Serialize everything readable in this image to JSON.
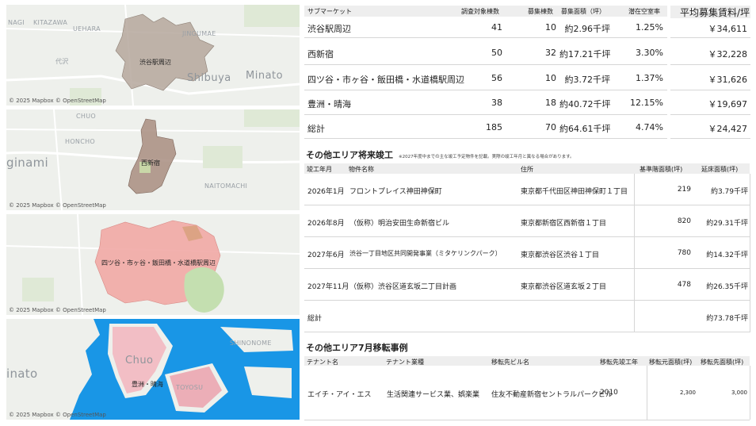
{
  "maps": [
    {
      "labels": [
        "NAGI",
        "KITAZAWA",
        "UEHARA",
        "JINGUMAE",
        "代沢",
        "Shibuya",
        "Minato"
      ],
      "area": "渋谷駅周辺",
      "copyright": "© 2025 Mapbox © OpenStreetMap",
      "color": "#b5a79c"
    },
    {
      "labels": [
        "CHUO",
        "HONCHO",
        "ginami",
        "NAITOMACHI"
      ],
      "area": "西新宿",
      "copyright": "© 2025 Mapbox © OpenStreetMap",
      "color": "#a88d80"
    },
    {
      "labels": [],
      "area": "四ツ谷・市ヶ谷・飯田橋・水道橋駅周辺",
      "copyright": "© 2025 Mapbox © OpenStreetMap",
      "color": "#f1a9a5"
    },
    {
      "labels": [
        "SHINONOME",
        "Chuo",
        "inato",
        "TOYOSU"
      ],
      "area": "豊洲・晴海",
      "copyright": "© 2025 Mapbox © OpenStreetMap",
      "color": "#eba6b1"
    }
  ],
  "submarket_table": {
    "headers": [
      "サブマーケット",
      "調査対象棟数",
      "募集棟数",
      "募集面積（坪）",
      "潜在空室率",
      "平均募集賃料/坪"
    ],
    "rows": [
      [
        "渋谷駅周辺",
        "41",
        "10",
        "約2.96千坪",
        "1.25%",
        "￥34,611"
      ],
      [
        "西新宿",
        "50",
        "32",
        "約17.21千坪",
        "3.30%",
        "￥32,228"
      ],
      [
        "四ツ谷・市ヶ谷・飯田橋・水道橋駅周辺",
        "56",
        "10",
        "約3.72千坪",
        "1.37%",
        "￥31,626"
      ],
      [
        "豊洲・晴海",
        "38",
        "18",
        "約40.72千坪",
        "12.15%",
        "￥19,697"
      ],
      [
        "総計",
        "185",
        "70",
        "約64.61千坪",
        "4.74%",
        "￥24,427"
      ]
    ]
  },
  "future_section": {
    "title": "その他エリア将来竣工",
    "note": "※2027年度中までの主な竣工予定物件を記載。実際の竣工年月と異なる場合があります。",
    "headers": [
      "竣工年月",
      "物件名称",
      "住所",
      "基準階面積(坪)",
      "延床面積(坪)"
    ],
    "rows": [
      [
        "2026年1月",
        "フロントプレイス神田神保町",
        "東京都千代田区神田神保町１丁目",
        "219",
        "約3.79千坪"
      ],
      [
        "2026年8月",
        "（仮称）明治安田生命新宿ビル",
        "東京都新宿区西新宿１丁目",
        "820",
        "約29.31千坪"
      ],
      [
        "2027年6月",
        "渋谷一丁目地区共同開発事業（ミタケリンクパーク）",
        "東京都渋谷区渋谷１丁目",
        "780",
        "約14.32千坪"
      ],
      [
        "2027年11月",
        "（仮称）渋谷区道玄坂二丁目計画",
        "東京都渋谷区道玄坂２丁目",
        "478",
        "約26.35千坪"
      ]
    ],
    "total_label": "総計",
    "total_value": "約73.78千坪"
  },
  "relocation_section": {
    "title": "その他エリア7月移転事例",
    "headers": [
      "テナント名",
      "テナント業種",
      "移転先ビル名",
      "移転先竣工年",
      "移転元面積(坪)",
      "移転先面積(坪)"
    ],
    "rows": [
      [
        "エイチ・アイ・エス",
        "生活関連サービス業、娯楽業",
        "住友不動産新宿セントラルパークビル",
        "2010",
        "2,300",
        "3,000"
      ]
    ]
  }
}
